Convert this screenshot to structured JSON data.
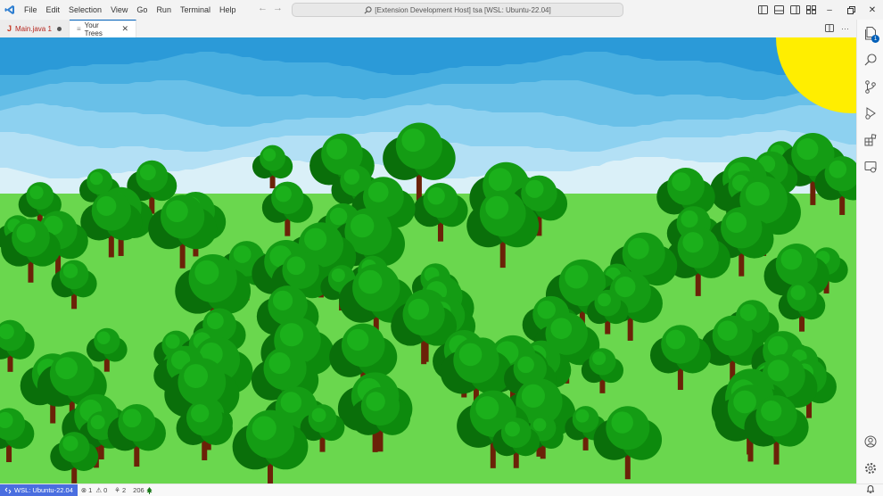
{
  "menu": [
    "File",
    "Edit",
    "Selection",
    "View",
    "Go",
    "Run",
    "Terminal",
    "Help"
  ],
  "command_center": {
    "text": "[Extension Development Host] tsa [WSL: Ubuntu-22.04]"
  },
  "tabs": [
    {
      "icon": "J",
      "label": "Main.java 1",
      "modified": true
    },
    {
      "icon": "≡",
      "label": "Your Trees",
      "active": true
    }
  ],
  "activity": {
    "explorer_badge": "1"
  },
  "status": {
    "remote": "WSL: Ubuntu-22.04",
    "errors": "1",
    "warnings": "0",
    "ports": "2",
    "tree_count": "206"
  },
  "scene": {
    "sky_colors": [
      "#2b9ad8",
      "#47aee0",
      "#69c0e8",
      "#8dd1f0",
      "#b3e0f5",
      "#daf0f8"
    ],
    "sun_color": "#ffee00",
    "grass_color": "#6ad74e",
    "foliage_colors": [
      "#0d8a0d",
      "#149c14",
      "#1bb01b",
      "#0a6f0a"
    ],
    "trunk_color": "#6b2208"
  }
}
